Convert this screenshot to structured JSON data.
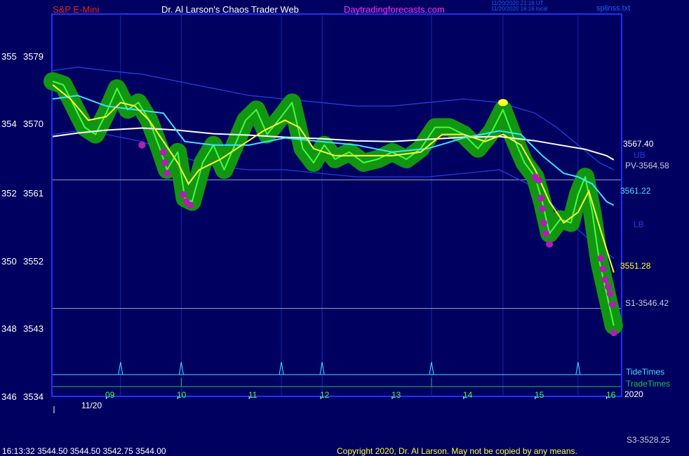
{
  "header": {
    "symbol": "S&P E-Mini",
    "site_title": "Dr. Al Larson's Chaos Trader Web",
    "site_url": "Daytradingforecasts.com",
    "time_utc": "11/20/2020 21:16 UT",
    "time_local": "11/20/2020 16:16 local",
    "file": "splinss.txt"
  },
  "footer": {
    "quote": "16:13:32  3544.50 3544.50 3542.75 3544.00",
    "copyright": "Copyright 2020, Dr. Al Larson. May not be copied by any means.",
    "s3_label": "S3-3528.25"
  },
  "colors": {
    "background": "#000060",
    "frame": "#2030ff",
    "price": "#40ff40",
    "halo": "#129612",
    "fast_ma": "#ffff30",
    "medium_ma": "#40e0ff",
    "slow_ma": "#ffffff",
    "envelope": "#2040e0",
    "magenta": "#b020b0",
    "tide": "#40e0ff",
    "trade": "#20c050",
    "title_red": "#e02020",
    "title_white": "#ffffff",
    "title_magenta": "#ff30ff"
  },
  "chart_data": {
    "type": "line",
    "x_ticks": [
      "09",
      "10",
      "11",
      "12",
      "13",
      "14",
      "15",
      "16"
    ],
    "x_date_label": "11/20",
    "x_year_label": "2020",
    "y_ticks": [
      {
        "left": "355",
        "value": 3579
      },
      {
        "left": "354",
        "value": 3570
      },
      {
        "left": "352",
        "value": 3561
      },
      {
        "left": "350",
        "value": 3552
      },
      {
        "left": "348",
        "value": 3543
      },
      {
        "left": "346",
        "value": 3534
      }
    ],
    "ylim": [
      3534,
      3588
    ],
    "xlim": [
      8.25,
      16.2
    ],
    "labels": {
      "slow": "3567.40",
      "medium": "3561.22",
      "fast": "3551.28",
      "ub": "UB",
      "lb": "LB",
      "pv": "PV-3564.58",
      "s1": "S1-3546.42",
      "tide_times": "TideTimes",
      "trade_times": "TradeTimes"
    },
    "levels": {
      "pv": 3564.58,
      "s1": 3546.42
    },
    "tide_spikes": [
      9.2,
      10.05,
      11.45,
      12.02,
      13.55,
      15.6
    ],
    "trade_spikes": [
      10.05,
      13.55
    ],
    "price": {
      "x": [
        8.25,
        8.4,
        8.55,
        8.7,
        8.85,
        9.0,
        9.15,
        9.3,
        9.45,
        9.6,
        9.75,
        9.85,
        10.0,
        10.1,
        10.2,
        10.35,
        10.5,
        10.65,
        10.8,
        10.95,
        11.1,
        11.25,
        11.45,
        11.6,
        11.75,
        11.9,
        12.05,
        12.2,
        12.4,
        12.6,
        12.8,
        13.0,
        13.2,
        13.4,
        13.6,
        13.8,
        14.0,
        14.2,
        14.4,
        14.55,
        14.7,
        14.85,
        15.0,
        15.1,
        15.2,
        15.35,
        15.5,
        15.6,
        15.7,
        15.8,
        15.9,
        16.0,
        16.1
      ],
      "y": [
        3578.5,
        3578.0,
        3575.0,
        3572.0,
        3571.0,
        3574.0,
        3577.5,
        3574.5,
        3575.5,
        3573.0,
        3569.0,
        3566.0,
        3568.5,
        3562.0,
        3561.5,
        3567.0,
        3569.5,
        3566.0,
        3569.5,
        3573.0,
        3574.5,
        3571.0,
        3573.5,
        3575.5,
        3569.0,
        3567.0,
        3569.5,
        3567.5,
        3568.5,
        3567.0,
        3567.5,
        3568.5,
        3567.5,
        3569.0,
        3572.0,
        3572.0,
        3571.0,
        3569.0,
        3571.5,
        3574.5,
        3570.5,
        3567.0,
        3565.0,
        3561.5,
        3557.0,
        3559.0,
        3558.5,
        3562.5,
        3565.0,
        3560.0,
        3553.0,
        3548.5,
        3544.0
      ]
    },
    "fast_ma": {
      "x": [
        8.25,
        8.5,
        8.75,
        9.0,
        9.2,
        9.4,
        9.6,
        9.8,
        10.0,
        10.15,
        10.3,
        10.6,
        10.9,
        11.2,
        11.5,
        11.7,
        11.9,
        12.2,
        12.6,
        13.0,
        13.4,
        13.7,
        14.0,
        14.3,
        14.55,
        14.8,
        15.0,
        15.2,
        15.4,
        15.6,
        15.75,
        15.9,
        16.1
      ],
      "y": [
        3578,
        3576,
        3573,
        3573.5,
        3575.5,
        3575,
        3573,
        3570,
        3567,
        3564,
        3566,
        3567.5,
        3569.5,
        3571.5,
        3573,
        3572,
        3569,
        3568,
        3568,
        3568,
        3568.5,
        3571,
        3571,
        3570,
        3571,
        3569.5,
        3566,
        3561.5,
        3558.5,
        3560,
        3563,
        3558,
        3551.5
      ]
    },
    "medium_ma": {
      "x": [
        8.25,
        8.6,
        9.0,
        9.4,
        9.8,
        10.1,
        10.5,
        11.0,
        11.5,
        12.0,
        12.5,
        13.0,
        13.5,
        14.0,
        14.5,
        14.8,
        15.1,
        15.4,
        15.6,
        15.8,
        16.0,
        16.1
      ],
      "y": [
        3576,
        3576.5,
        3575,
        3574.5,
        3574,
        3570,
        3569.5,
        3569.5,
        3570.5,
        3570,
        3569.5,
        3568.5,
        3569,
        3570.5,
        3571.5,
        3571,
        3568,
        3565.5,
        3565,
        3564,
        3561.5,
        3561
      ]
    },
    "slow_ma": {
      "x": [
        8.25,
        8.6,
        9.0,
        9.5,
        10.0,
        10.5,
        11.0,
        11.5,
        12.0,
        12.5,
        13.0,
        13.5,
        14.0,
        14.5,
        15.0,
        15.4,
        15.7,
        16.0,
        16.1
      ],
      "y": [
        3570.7,
        3571.2,
        3571.6,
        3571.9,
        3571.6,
        3571.1,
        3570.9,
        3570.6,
        3570.4,
        3570.1,
        3570.0,
        3570.3,
        3570.6,
        3570.7,
        3570.1,
        3569.4,
        3568.9,
        3568.0,
        3567.4
      ]
    },
    "upper_band": {
      "x": [
        8.25,
        8.6,
        9.0,
        9.5,
        10.0,
        10.5,
        11.0,
        11.5,
        12.0,
        12.5,
        13.0,
        13.5,
        14.0,
        14.5,
        15.0,
        15.3,
        15.6,
        15.9,
        16.1
      ],
      "y": [
        3580,
        3580.5,
        3580,
        3579.5,
        3578.5,
        3577.5,
        3576.5,
        3576,
        3575.5,
        3575,
        3575,
        3575.5,
        3576,
        3575.5,
        3574,
        3572,
        3569.5,
        3567,
        3566
      ]
    },
    "lower_band": {
      "x": [
        8.25,
        8.6,
        9.0,
        9.5,
        10.0,
        10.5,
        11.0,
        11.5,
        12.0,
        12.5,
        13.0,
        13.5,
        14.0,
        14.5,
        15.0,
        15.3,
        15.6,
        15.9,
        16.1
      ],
      "y": [
        3571,
        3571.5,
        3571,
        3570,
        3568,
        3566.5,
        3566,
        3566,
        3565.5,
        3565,
        3565,
        3565,
        3565.5,
        3566,
        3563.5,
        3560.5,
        3557.5,
        3555,
        3553.5
      ]
    },
    "magenta_points": [
      {
        "x": 9.5,
        "y": 3569.5
      },
      {
        "x": 9.8,
        "y": 3568.5
      },
      {
        "x": 9.82,
        "y": 3567
      },
      {
        "x": 9.85,
        "y": 3565.5
      },
      {
        "x": 10.08,
        "y": 3562.5
      },
      {
        "x": 10.12,
        "y": 3561.5
      },
      {
        "x": 10.18,
        "y": 3561
      },
      {
        "x": 15.0,
        "y": 3565
      },
      {
        "x": 15.05,
        "y": 3564.5
      },
      {
        "x": 15.08,
        "y": 3562
      },
      {
        "x": 15.1,
        "y": 3560.5
      },
      {
        "x": 15.12,
        "y": 3558.5
      },
      {
        "x": 15.15,
        "y": 3557
      },
      {
        "x": 15.2,
        "y": 3555.5
      },
      {
        "x": 15.92,
        "y": 3553.5
      },
      {
        "x": 15.95,
        "y": 3552
      },
      {
        "x": 15.98,
        "y": 3550.5
      },
      {
        "x": 16.02,
        "y": 3549.5
      },
      {
        "x": 16.05,
        "y": 3548.5
      },
      {
        "x": 16.08,
        "y": 3547
      },
      {
        "x": 16.1,
        "y": 3543
      }
    ],
    "yellow_point": {
      "x": 14.55,
      "y": 3575.5
    }
  }
}
